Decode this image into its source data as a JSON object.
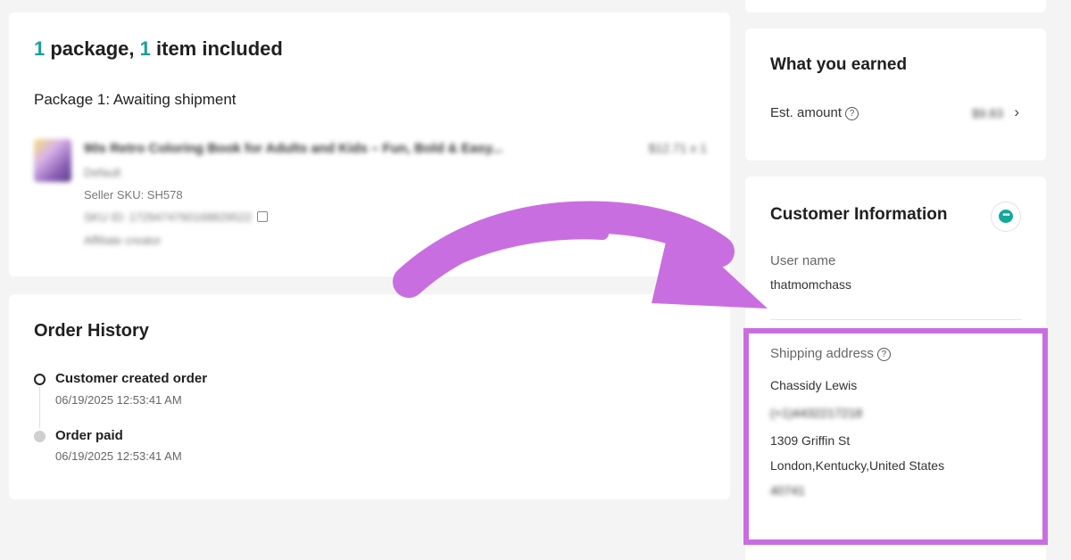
{
  "package_card": {
    "title_count1": "1",
    "title_text1": " package, ",
    "title_count2": "1",
    "title_text2": " item included",
    "package_status": "Package 1: Awaiting shipment",
    "product": {
      "name": "90s Retro Coloring Book for Adults and Kids – Fun, Bold & Easy...",
      "price_qty": "$12.71 x 1",
      "variant": "Default",
      "seller_sku": "Seller SKU: SH578",
      "sku_id": "SKU ID: 1729474760168829522",
      "tag": "Affiliate creator"
    }
  },
  "order_history": {
    "title": "Order History",
    "events": [
      {
        "label": "Customer created order",
        "time": "06/19/2025 12:53:41 AM"
      },
      {
        "label": "Order paid",
        "time": "06/19/2025 12:53:41 AM"
      }
    ]
  },
  "earnings": {
    "title": "What you earned",
    "label": "Est. amount",
    "amount": "$9.83"
  },
  "customer": {
    "title": "Customer Information",
    "username_label": "User name",
    "username": "thatmomchass",
    "shipping_label": "Shipping address",
    "name": "Chassidy Lewis",
    "phone": "(+1)4432217218",
    "street": "1309 Griffin St",
    "city_line": "London,Kentucky,United States",
    "zip": "40741"
  },
  "icons": {
    "help": "help-circle-icon",
    "chevron": "chevron-right-icon",
    "chat": "chat-bubble-icon",
    "copy": "copy-icon"
  },
  "colors": {
    "accent_teal": "#1b9e98",
    "highlight_purple": "#c96ee0"
  }
}
